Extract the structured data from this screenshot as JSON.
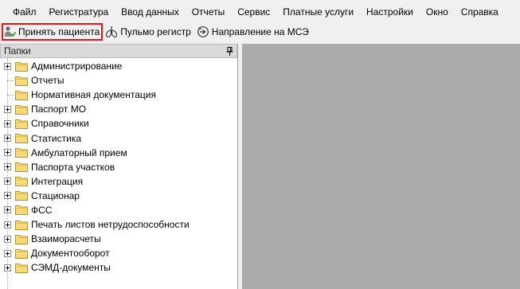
{
  "menu": {
    "items": [
      {
        "label": "Файл"
      },
      {
        "label": "Регистратура"
      },
      {
        "label": "Ввод данных"
      },
      {
        "label": "Отчеты"
      },
      {
        "label": "Сервис"
      },
      {
        "label": "Платные услуги"
      },
      {
        "label": "Настройки"
      },
      {
        "label": "Окно"
      },
      {
        "label": "Справка"
      }
    ]
  },
  "toolbar": {
    "accept_patient": {
      "label": "Принять пациента",
      "icon": "accept-patient-icon"
    },
    "pulmo_register": {
      "label": "Пульмо регистр",
      "icon": "lungs-icon"
    },
    "mse_referral": {
      "label": "Направление на МСЭ",
      "icon": "referral-icon"
    },
    "highlight_color": "#e81616"
  },
  "panel": {
    "title": "Папки",
    "pin_icon": "pin-icon"
  },
  "tree": {
    "items": [
      {
        "label": "Администрирование",
        "expandable": true
      },
      {
        "label": "Отчеты",
        "expandable": false
      },
      {
        "label": "Нормативная документация",
        "expandable": false
      },
      {
        "label": "Паспорт МО",
        "expandable": true
      },
      {
        "label": "Справочники",
        "expandable": true
      },
      {
        "label": "Статистика",
        "expandable": true
      },
      {
        "label": "Амбулаторный прием",
        "expandable": true
      },
      {
        "label": "Паспорта участков",
        "expandable": true
      },
      {
        "label": "Интеграция",
        "expandable": true
      },
      {
        "label": "Стационар",
        "expandable": true
      },
      {
        "label": "ФСС",
        "expandable": true
      },
      {
        "label": "Печать листов нетрудоспособности",
        "expandable": true
      },
      {
        "label": "Взаиморасчеты",
        "expandable": true
      },
      {
        "label": "Документооборот",
        "expandable": true
      },
      {
        "label": "СЭМД-документы",
        "expandable": true
      }
    ]
  },
  "colors": {
    "workspace": "#ababab",
    "folder": "#f5d76e"
  }
}
